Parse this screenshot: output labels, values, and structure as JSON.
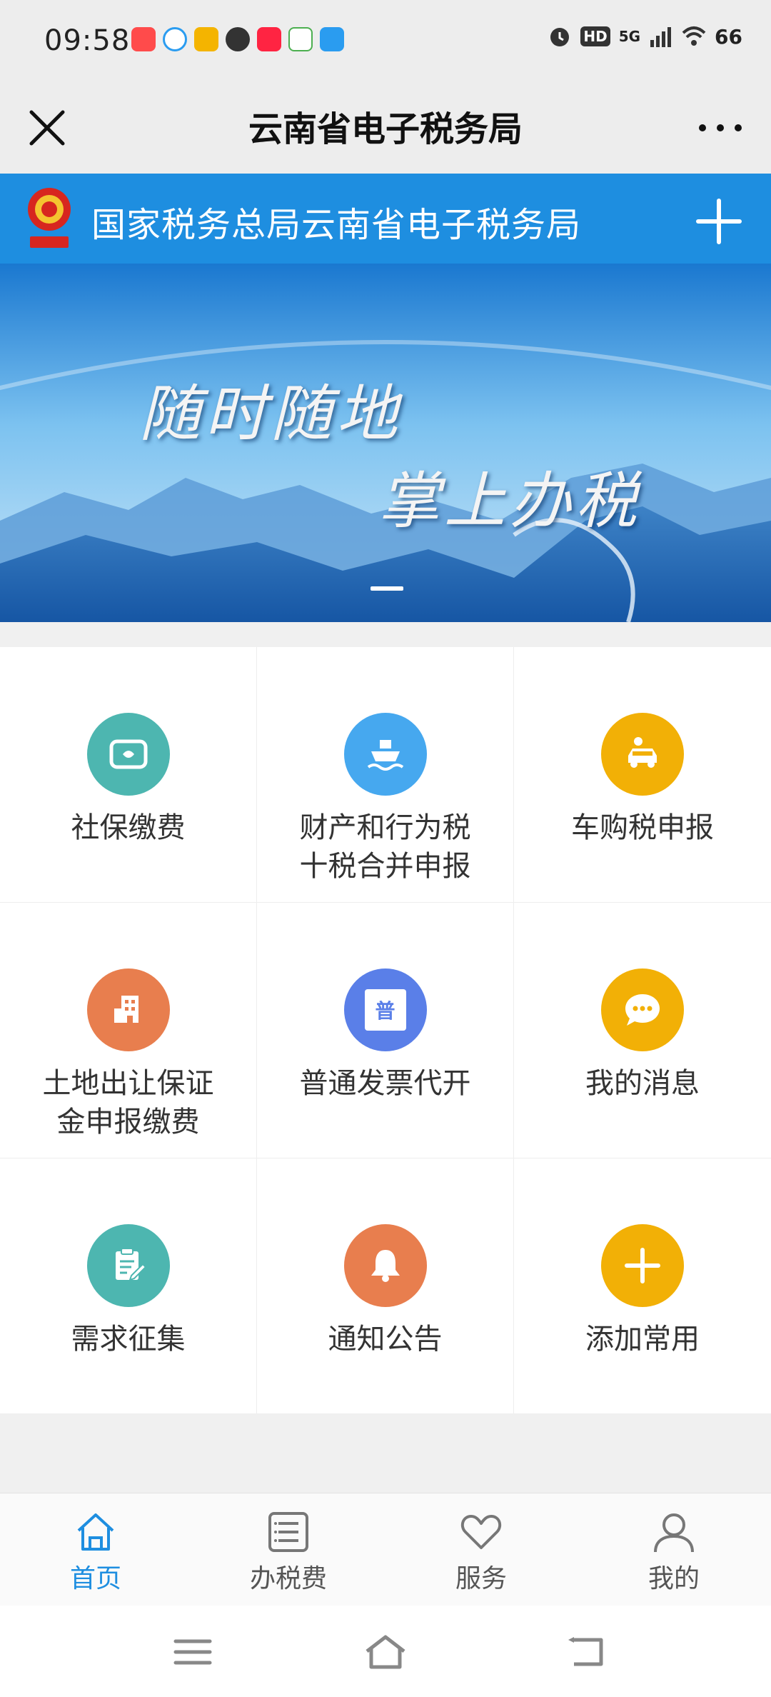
{
  "status_bar": {
    "time": "09:58",
    "network": "5G",
    "battery": "66",
    "hd": "HD"
  },
  "title_bar": {
    "title": "云南省电子税务局",
    "close_icon": "close-icon",
    "more_icon": "more-icon"
  },
  "header": {
    "title": "国家税务总局云南省电子税务局",
    "add_icon": "plus-icon"
  },
  "banner": {
    "line1": "随时随地",
    "line2": "掌上办税"
  },
  "grid": [
    {
      "label": "社保缴费",
      "icon": "social-security-icon",
      "color": "#4db6b0"
    },
    {
      "label": "财产和行为税十税合并申报",
      "icon": "ship-icon",
      "color": "#46a8ef"
    },
    {
      "label": "车购税申报",
      "icon": "car-icon",
      "color": "#f2b006"
    },
    {
      "label": "土地出让保证金申报缴费",
      "icon": "building-icon",
      "color": "#e87e4e"
    },
    {
      "label": "普通发票代开",
      "icon": "invoice-icon",
      "color": "#5a7fe8"
    },
    {
      "label": "我的消息",
      "icon": "message-icon",
      "color": "#f2b006"
    },
    {
      "label": "需求征集",
      "icon": "clipboard-icon",
      "color": "#4db6b0"
    },
    {
      "label": "通知公告",
      "icon": "bell-icon",
      "color": "#e87e4e"
    },
    {
      "label": "添加常用",
      "icon": "plus-icon",
      "color": "#f2b006"
    }
  ],
  "grid_lines": [
    [
      "社保缴费"
    ],
    [
      "财产和行为税",
      "十税合并申报"
    ],
    [
      "车购税申报"
    ],
    [
      "土地出让保证",
      "金申报缴费"
    ],
    [
      "普通发票代开"
    ],
    [
      "我的消息"
    ],
    [
      "需求征集"
    ],
    [
      "通知公告"
    ],
    [
      "添加常用"
    ]
  ],
  "invoice_glyph": "普",
  "tabs": [
    {
      "label": "首页",
      "icon": "home-icon",
      "active": true
    },
    {
      "label": "办税费",
      "icon": "list-icon",
      "active": false
    },
    {
      "label": "服务",
      "icon": "heart-icon",
      "active": false
    },
    {
      "label": "我的",
      "icon": "user-icon",
      "active": false
    }
  ],
  "colors": {
    "accent": "#1e8ee0",
    "header_bg": "#1e8ee0"
  }
}
